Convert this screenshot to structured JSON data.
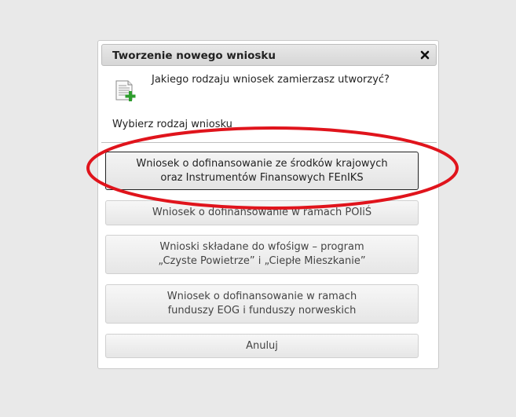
{
  "dialog": {
    "title": "Tworzenie nowego wniosku",
    "close_icon": "close-icon",
    "question": "Jakiego rodzaju wniosek zamierzasz utworzyć?",
    "doc_icon": "document-add-icon",
    "choose_label": "Wybierz rodzaj wniosku"
  },
  "options": [
    {
      "line1": "Wniosek o dofinansowanie ze środków krajowych",
      "line2": "oraz Instrumentów Finansowych FEnIKS"
    },
    {
      "line1": "Wniosek o dofinansowanie w ramach POIiŚ",
      "line2": ""
    },
    {
      "line1": "Wnioski składane do wfośigw – program",
      "line2": "„Czyste Powietrze” i „Ciepłe Mieszkanie”"
    },
    {
      "line1": "Wniosek o dofinansowanie w ramach",
      "line2": "funduszy EOG i funduszy norweskich"
    }
  ],
  "cancel_label": "Anuluj",
  "colors": {
    "highlight_ellipse": "#e0141c",
    "page_background": "#e9e9e9"
  }
}
